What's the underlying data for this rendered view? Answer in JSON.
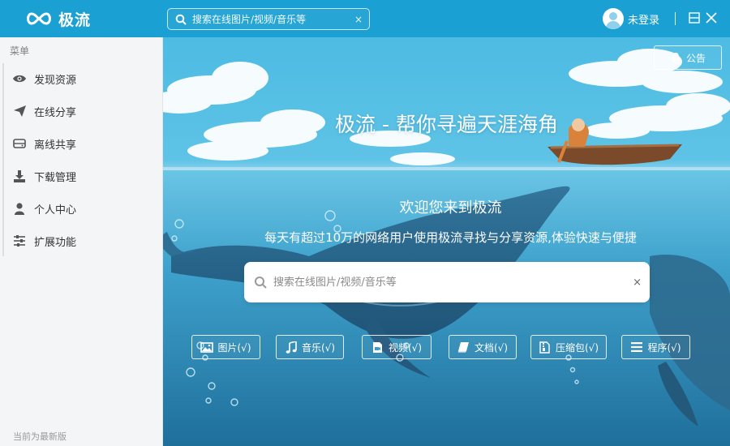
{
  "app": {
    "brand": "极流"
  },
  "titlebar": {
    "search": {
      "placeholder": "搜索在线图片/视频/音乐等",
      "clear_icon": "×"
    },
    "user": {
      "login_label": "未登录"
    }
  },
  "sidebar": {
    "menu_title": "菜单",
    "items": [
      {
        "label": "发现资源",
        "icon": "eye-icon"
      },
      {
        "label": "在线分享",
        "icon": "paper-plane-icon"
      },
      {
        "label": "离线共享",
        "icon": "hard-drive-icon"
      },
      {
        "label": "下载管理",
        "icon": "download-icon"
      },
      {
        "label": "个人中心",
        "icon": "user-icon"
      },
      {
        "label": "扩展功能",
        "icon": "sliders-icon"
      }
    ],
    "version_note": "当前为最新版"
  },
  "main": {
    "notice_label": "公告",
    "hero_title": "极流 - 帮你寻遍天涯海角",
    "welcome": "欢迎您来到极流",
    "slogan": "每天有超过10万的网络用户使用极流寻找与分享资源,体验快速与便捷",
    "search": {
      "placeholder": "搜索在线图片/视频/音乐等",
      "clear_icon": "×"
    },
    "categories": [
      {
        "label": "图片(√)",
        "icon": "image-icon"
      },
      {
        "label": "音乐(√)",
        "icon": "music-icon"
      },
      {
        "label": "视频(√)",
        "icon": "video-file-icon"
      },
      {
        "label": "文档(√)",
        "icon": "book-icon"
      },
      {
        "label": "压缩包(√)",
        "icon": "archive-file-icon"
      },
      {
        "label": "程序(√)",
        "icon": "list-icon"
      }
    ]
  },
  "colors": {
    "titlebar": "#1aa0d2",
    "sidebar_bg": "#f4f5f7",
    "sky": "#4dbbe3",
    "sea": "#2e8fba"
  }
}
